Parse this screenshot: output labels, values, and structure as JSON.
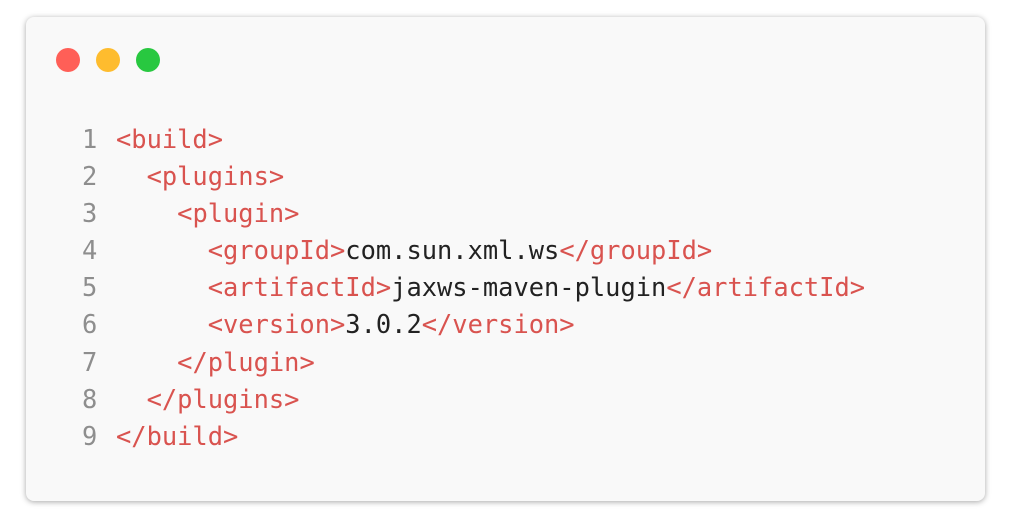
{
  "window": {
    "controls": [
      {
        "name": "close",
        "color": "#ff5f57"
      },
      {
        "name": "minimize",
        "color": "#febc2e"
      },
      {
        "name": "maximize",
        "color": "#28c840"
      }
    ]
  },
  "colors": {
    "tag": "#d9534f",
    "text": "#222222",
    "line_number": "#8e8e8e",
    "background": "#f9f9f9"
  },
  "code": {
    "lines": [
      {
        "n": "1",
        "indent": "",
        "open": "<build>",
        "text": "",
        "close": ""
      },
      {
        "n": "2",
        "indent": "  ",
        "open": "<plugins>",
        "text": "",
        "close": ""
      },
      {
        "n": "3",
        "indent": "    ",
        "open": "<plugin>",
        "text": "",
        "close": ""
      },
      {
        "n": "4",
        "indent": "      ",
        "open": "<groupId>",
        "text": "com.sun.xml.ws",
        "close": "</groupId>"
      },
      {
        "n": "5",
        "indent": "      ",
        "open": "<artifactId>",
        "text": "jaxws-maven-plugin",
        "close": "</artifactId>"
      },
      {
        "n": "6",
        "indent": "      ",
        "open": "<version>",
        "text": "3.0.2",
        "close": "</version>"
      },
      {
        "n": "7",
        "indent": "    ",
        "open": "</plugin>",
        "text": "",
        "close": ""
      },
      {
        "n": "8",
        "indent": "  ",
        "open": "</plugins>",
        "text": "",
        "close": ""
      },
      {
        "n": "9",
        "indent": "",
        "open": "</build>",
        "text": "",
        "close": ""
      }
    ]
  }
}
